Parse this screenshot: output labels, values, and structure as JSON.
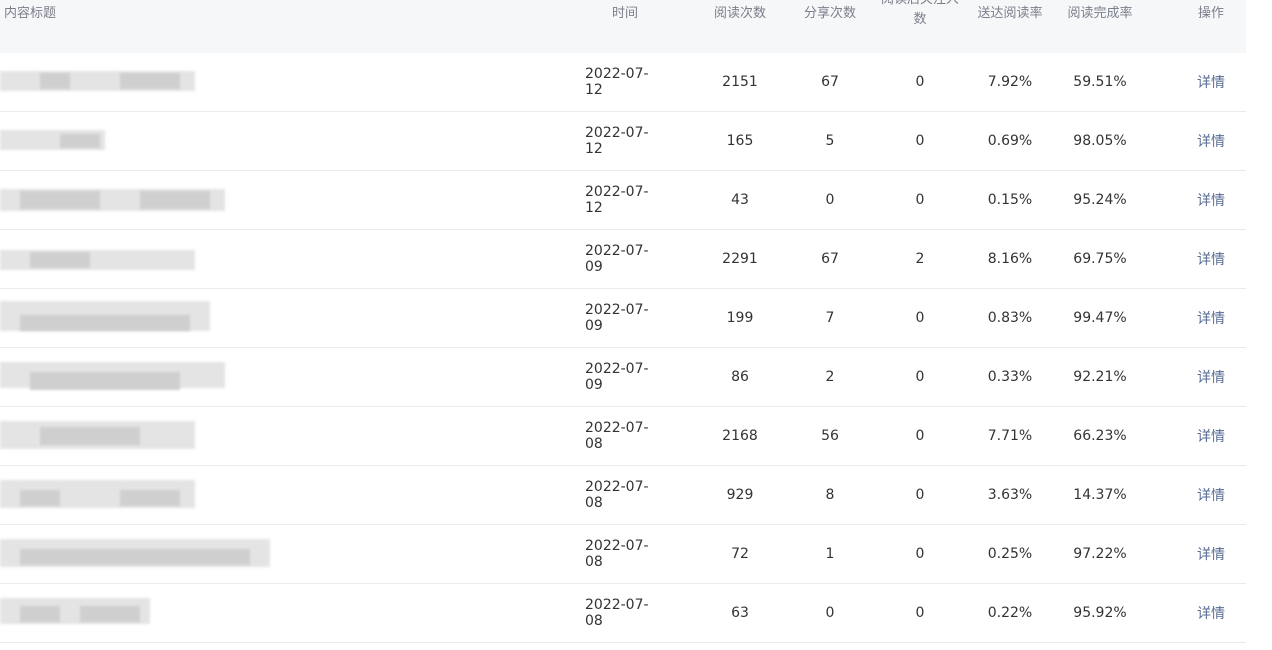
{
  "columns": {
    "title": "内容标题",
    "time": "时间",
    "reads": "阅读次数",
    "shares": "分享次数",
    "follows": "阅读后关注人数",
    "reach_rate": "送达阅读率",
    "completion_rate": "阅读完成率",
    "action": "操作"
  },
  "rows": [
    {
      "time": "2022-07-12",
      "reads": "2151",
      "shares": "67",
      "follows": "0",
      "reach_rate": "7.92%",
      "completion_rate": "59.51%",
      "action": "详情"
    },
    {
      "time": "2022-07-12",
      "reads": "165",
      "shares": "5",
      "follows": "0",
      "reach_rate": "0.69%",
      "completion_rate": "98.05%",
      "action": "详情"
    },
    {
      "time": "2022-07-12",
      "reads": "43",
      "shares": "0",
      "follows": "0",
      "reach_rate": "0.15%",
      "completion_rate": "95.24%",
      "action": "详情"
    },
    {
      "time": "2022-07-09",
      "reads": "2291",
      "shares": "67",
      "follows": "2",
      "reach_rate": "8.16%",
      "completion_rate": "69.75%",
      "action": "详情"
    },
    {
      "time": "2022-07-09",
      "reads": "199",
      "shares": "7",
      "follows": "0",
      "reach_rate": "0.83%",
      "completion_rate": "99.47%",
      "action": "详情"
    },
    {
      "time": "2022-07-09",
      "reads": "86",
      "shares": "2",
      "follows": "0",
      "reach_rate": "0.33%",
      "completion_rate": "92.21%",
      "action": "详情"
    },
    {
      "time": "2022-07-08",
      "reads": "2168",
      "shares": "56",
      "follows": "0",
      "reach_rate": "7.71%",
      "completion_rate": "66.23%",
      "action": "详情"
    },
    {
      "time": "2022-07-08",
      "reads": "929",
      "shares": "8",
      "follows": "0",
      "reach_rate": "3.63%",
      "completion_rate": "14.37%",
      "action": "详情"
    },
    {
      "time": "2022-07-08",
      "reads": "72",
      "shares": "1",
      "follows": "0",
      "reach_rate": "0.25%",
      "completion_rate": "97.22%",
      "action": "详情"
    },
    {
      "time": "2022-07-08",
      "reads": "63",
      "shares": "0",
      "follows": "0",
      "reach_rate": "0.22%",
      "completion_rate": "95.92%",
      "action": "详情"
    }
  ]
}
